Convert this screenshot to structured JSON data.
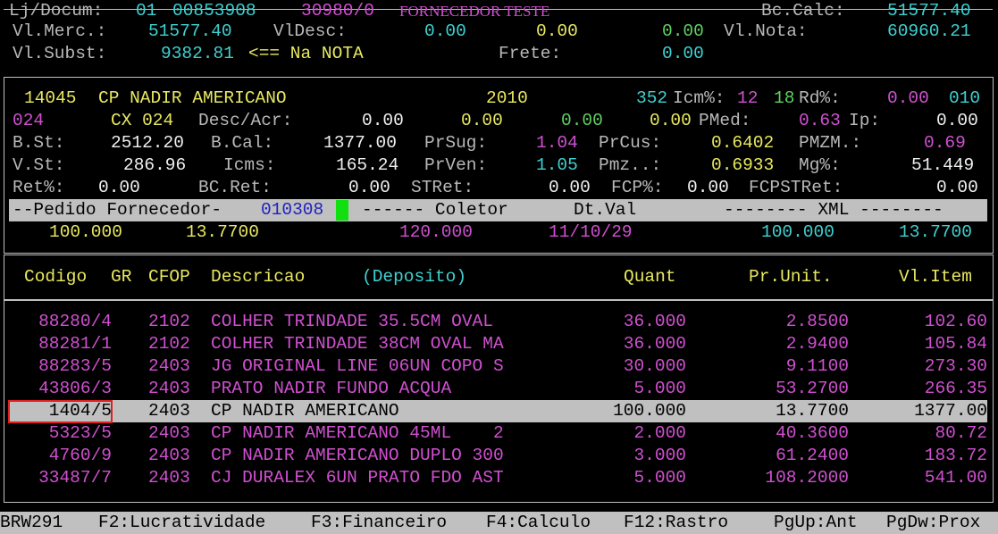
{
  "header": {
    "lj_label": "Lj/Docum:",
    "lj_store": "01",
    "lj_doc": "00853908",
    "lj_ref": "30980/0",
    "supplier": "FORNECEDOR TESTE",
    "bccalc_label": "Bc.Calc:",
    "bccalc_value": "51577.40",
    "vlmerc_label": "Vl.Merc.:",
    "vlmerc_value": "51577.40",
    "vldesc_label": "VlDesc:",
    "vldesc_value1": "0.00",
    "vldesc_value2": "0.00",
    "vldesc_value3": "0.00",
    "vlnota_label": "Vl.Nota:",
    "vlnota_value": "60960.21",
    "vlsubst_label": "Vl.Subst:",
    "vlsubst_value": "9382.81",
    "na_nota": "<== Na NOTA",
    "frete_label": "Frete:",
    "frete_value": "0.00"
  },
  "detail": {
    "r1_code": "14045",
    "r1_desc": "CP NADIR AMERICANO",
    "r1_year": "2010",
    "r1_icm_num": "352",
    "r1_icm_label": "Icm%:",
    "r1_icm_val": "12",
    "r1_rd_num": "18",
    "r1_rd_label": "Rd%:",
    "r1_rd_val": "0.00",
    "r1_rd_code": "010",
    "r2_code": "024",
    "r2_cx": "CX 024",
    "r2_descacr_label": "Desc/Acr:",
    "r2_v1": "0.00",
    "r2_v2": "0.00",
    "r2_v3": "0.00",
    "r2_v4": "0.00",
    "r2_pmed_label": "PMed:",
    "r2_pmed_val": "0.63",
    "r2_ip_label": "Ip:",
    "r2_ip_val": "0.00",
    "r3_bst_label": "B.St:",
    "r3_bst_val": "2512.20",
    "r3_bcal_label": "B.Cal:",
    "r3_bcal_val": "1377.00",
    "r3_prsug_label": "PrSug:",
    "r3_prsug_val": "1.04",
    "r3_prcus_label": "PrCus:",
    "r3_prcus_val": "0.6402",
    "r3_pmzm_label": "PMZM.:",
    "r3_pmzm_val": "0.69",
    "r4_vst_label": "V.St:",
    "r4_vst_val": "286.96",
    "r4_icms_label": "Icms:",
    "r4_icms_val": "165.24",
    "r4_prven_label": "PrVen:",
    "r4_prven_val": "1.05",
    "r4_pmz_label": "Pmz..:",
    "r4_pmz_val": "0.6933",
    "r4_mg_label": "Mg%:",
    "r4_mg_val": "51.449",
    "r5_ret_label": "Ret%:",
    "r5_ret_val": "0.00",
    "r5_bcret_label": "BC.Ret:",
    "r5_bcret_val": "0.00",
    "r5_stret_label": "STRet:",
    "r5_stret_val": "0.00",
    "r5_fcp_label": "FCP%:",
    "r5_fcp_val": "0.00",
    "r5_fcpst_label": "FCPSTRet:",
    "r5_fcpst_val": "0.00"
  },
  "order_bar": {
    "label": "--Pedido Fornecedor-",
    "order_no": "010308",
    "coletor_label": "------ Coletor",
    "dtval_label": "Dt.Val",
    "xml_label": "-------- XML --------",
    "qty": "100.000",
    "price": "13.7700",
    "coletor_qty": "120.000",
    "dt_val": "11/10/29",
    "xml_qty": "100.000",
    "xml_price": "13.7700"
  },
  "table": {
    "columns": [
      "Codigo",
      "GR",
      "CFOP",
      "Descricao",
      "(Deposito)",
      "Quant",
      "Pr.Unit.",
      "Vl.Item"
    ],
    "rows": [
      {
        "code": "88280/4",
        "cfop": "2102",
        "desc": "COLHER TRINDADE 35.5CM OVAL",
        "qty": "36.000",
        "unit": "2.8500",
        "total": "102.60"
      },
      {
        "code": "88281/1",
        "cfop": "2102",
        "desc": "COLHER TRINDADE 38CM OVAL MA",
        "qty": "36.000",
        "unit": "2.9400",
        "total": "105.84"
      },
      {
        "code": "88283/5",
        "cfop": "2403",
        "desc": "JG ORIGINAL LINE 06UN COPO S",
        "qty": "30.000",
        "unit": "9.1100",
        "total": "273.30"
      },
      {
        "code": "43806/3",
        "cfop": "2403",
        "desc": "PRATO NADIR FUNDO ACQUA",
        "qty": "5.000",
        "unit": "53.2700",
        "total": "266.35"
      },
      {
        "code": "1404/5",
        "cfop": "2403",
        "desc": "CP NADIR AMERICANO",
        "qty": "100.000",
        "unit": "13.7700",
        "total": "1377.00"
      },
      {
        "code": "5323/5",
        "cfop": "2403",
        "desc": "CP NADIR AMERICANO 45ML    2",
        "qty": "2.000",
        "unit": "40.3600",
        "total": "80.72"
      },
      {
        "code": "4760/9",
        "cfop": "2403",
        "desc": "CP NADIR AMERICANO DUPLO 300",
        "qty": "3.000",
        "unit": "61.2400",
        "total": "183.72"
      },
      {
        "code": "33487/7",
        "cfop": "2403",
        "desc": "CJ DURALEX 6UN PRATO FDO AST",
        "qty": "5.000",
        "unit": "108.2000",
        "total": "541.00"
      }
    ],
    "selected_row": 4
  },
  "footer": {
    "screen_id": "BRW291",
    "f2": "F2:Lucratividade",
    "f3": "F3:Financeiro",
    "f4": "F4:Calculo",
    "f12": "F12:Rastro",
    "pgup": "PgUp:Ant",
    "pgdw": "PgDw:Prox"
  },
  "colors": {
    "label": "#b8b8b8",
    "value": "#f0f0f0",
    "cyan": "#40d0d0",
    "yellow": "#e8e860",
    "magenta": "#d050d0",
    "green": "#60d060",
    "selection_bg": "#c0c0c0",
    "selection_border": "#e02020"
  }
}
